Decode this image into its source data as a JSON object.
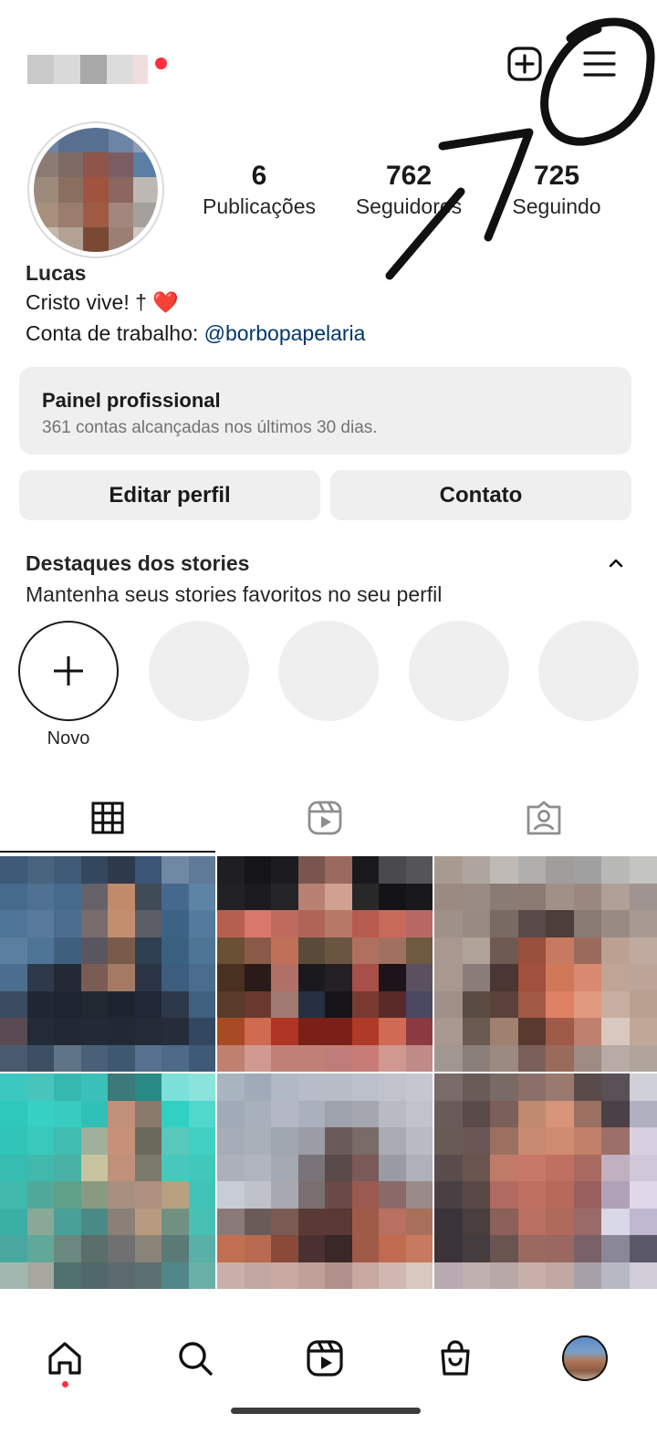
{
  "profile": {
    "display_name": "Lucas",
    "bio_line1": "Cristo vive! † ❤️",
    "bio_work_prefix": "Conta de trabalho: ",
    "bio_work_handle": "@borbopapelaria"
  },
  "stats": [
    {
      "value": "6",
      "label": "Publicações"
    },
    {
      "value": "762",
      "label": "Seguidores"
    },
    {
      "value": "725",
      "label": "Seguindo"
    }
  ],
  "pro_dashboard": {
    "title": "Painel profissional",
    "subtitle": "361 contas alcançadas nos últimos 30 dias."
  },
  "buttons": {
    "edit_profile": "Editar perfil",
    "contact": "Contato"
  },
  "highlights": {
    "title": "Destaques dos stories",
    "subtitle": "Mantenha seus stories favoritos no seu perfil",
    "new_label": "Novo"
  },
  "tabs": [
    {
      "icon": "grid-icon",
      "selected": true
    },
    {
      "icon": "reels-icon",
      "selected": false
    },
    {
      "icon": "tagged-icon",
      "selected": false
    }
  ],
  "bottom_nav": [
    {
      "icon": "home-icon",
      "active": true
    },
    {
      "icon": "search-icon",
      "active": false
    },
    {
      "icon": "reels-icon",
      "active": false
    },
    {
      "icon": "shop-icon",
      "active": false
    },
    {
      "icon": "profile-avatar",
      "active": false
    }
  ],
  "colors": {
    "notification": "#ff3040",
    "link": "#00376b",
    "button_bg": "#efefef"
  }
}
